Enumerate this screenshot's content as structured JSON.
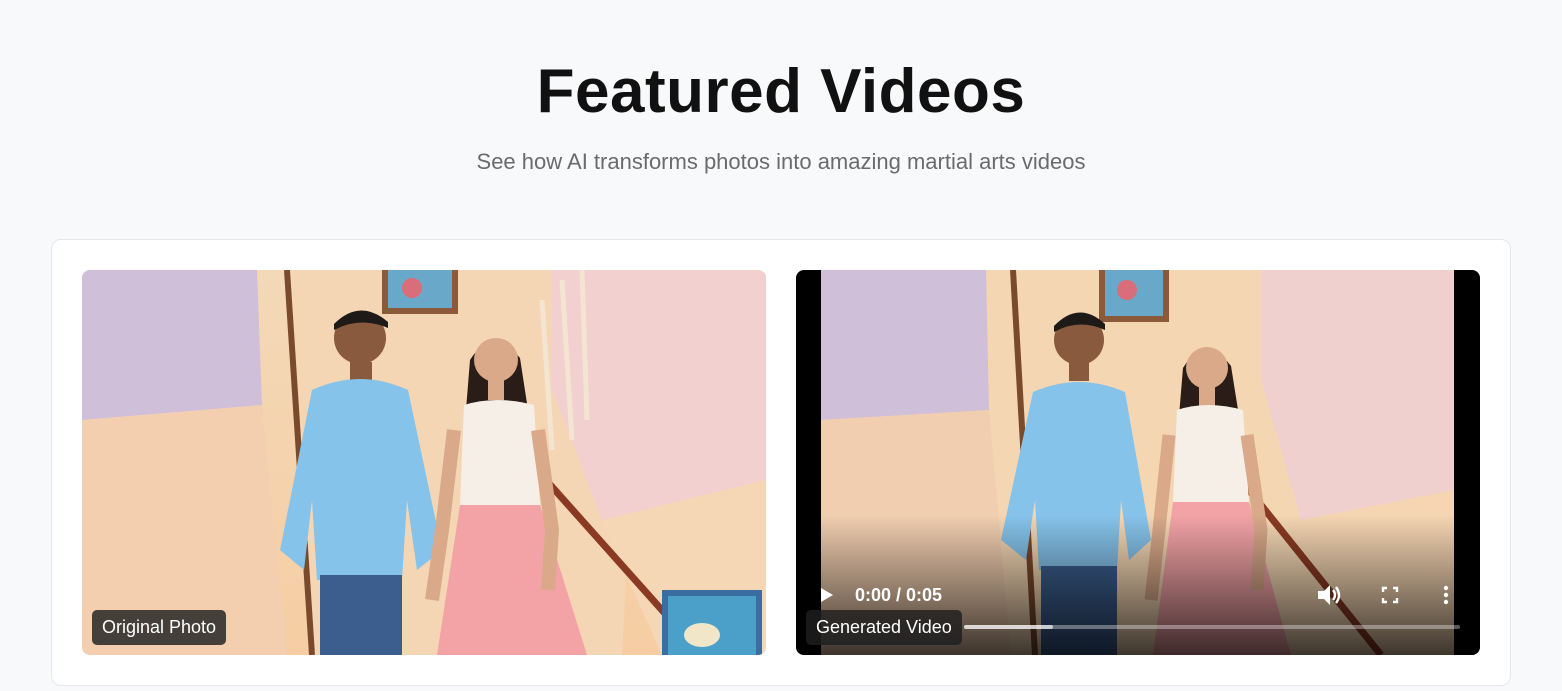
{
  "header": {
    "title": "Featured Videos",
    "subtitle": "See how AI transforms photos into amazing martial arts videos"
  },
  "comparison": {
    "original": {
      "label": "Original Photo"
    },
    "generated": {
      "label": "Generated Video",
      "time_display": "0:00 / 0:05",
      "progress": 0.18
    }
  },
  "icons": [
    "play-icon",
    "volume-icon",
    "fullscreen-icon",
    "more-options-icon"
  ],
  "colors": {
    "page_bg": "#f8f9fb",
    "card_bg": "#ffffff",
    "title": "#111111",
    "subtitle": "#6b6b6b"
  }
}
